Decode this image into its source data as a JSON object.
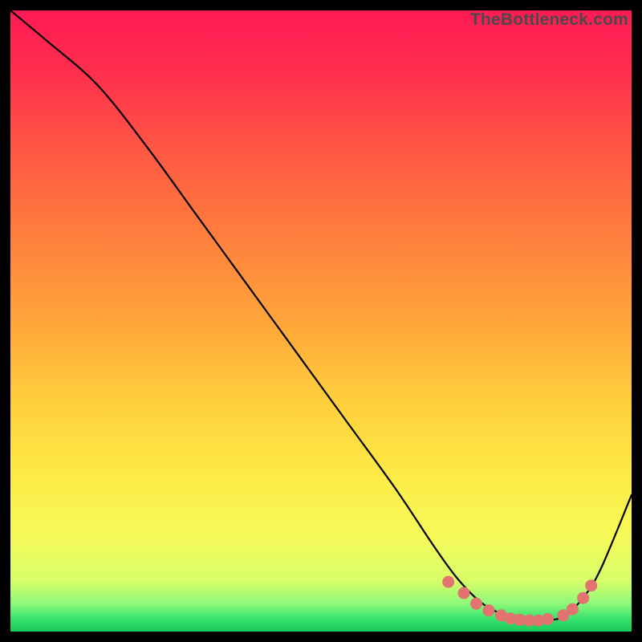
{
  "watermark": "TheBottleneck.com",
  "gradient": {
    "stops": [
      {
        "offset": 0.0,
        "color": "#ff1a54"
      },
      {
        "offset": 0.1,
        "color": "#ff2f4d"
      },
      {
        "offset": 0.22,
        "color": "#ff5644"
      },
      {
        "offset": 0.35,
        "color": "#ff7b3e"
      },
      {
        "offset": 0.5,
        "color": "#ffa53a"
      },
      {
        "offset": 0.63,
        "color": "#ffcf3c"
      },
      {
        "offset": 0.75,
        "color": "#fdeb46"
      },
      {
        "offset": 0.85,
        "color": "#f6fb5a"
      },
      {
        "offset": 0.92,
        "color": "#d6fd6a"
      },
      {
        "offset": 0.955,
        "color": "#8df87a"
      },
      {
        "offset": 0.978,
        "color": "#3be56e"
      },
      {
        "offset": 1.0,
        "color": "#16c95b"
      }
    ]
  },
  "chart_data": {
    "type": "line",
    "title": "",
    "xlabel": "",
    "ylabel": "",
    "xlim": [
      0,
      100
    ],
    "ylim": [
      0,
      100
    ],
    "series": [
      {
        "name": "curve",
        "x": [
          0,
          6,
          14,
          22,
          30,
          38,
          46,
          54,
          62,
          68,
          72,
          76,
          80,
          83,
          86,
          89,
          92,
          95,
          100
        ],
        "y": [
          100,
          95,
          88,
          78,
          67,
          56,
          45,
          34,
          23,
          14,
          8.5,
          4.5,
          2.5,
          1.8,
          1.8,
          2.4,
          5.2,
          10,
          22
        ]
      }
    ],
    "highlight": {
      "name": "dots",
      "color": "#e2736f",
      "radius": 7.5,
      "x": [
        70.5,
        73.0,
        75.0,
        77.0,
        79.0,
        80.5,
        82.0,
        83.5,
        85.0,
        86.5,
        89.0,
        90.5,
        92.2,
        93.5
      ],
      "y": [
        8.0,
        6.2,
        4.5,
        3.4,
        2.6,
        2.1,
        1.9,
        1.8,
        1.8,
        2.0,
        2.6,
        3.6,
        5.4,
        7.4
      ]
    }
  }
}
